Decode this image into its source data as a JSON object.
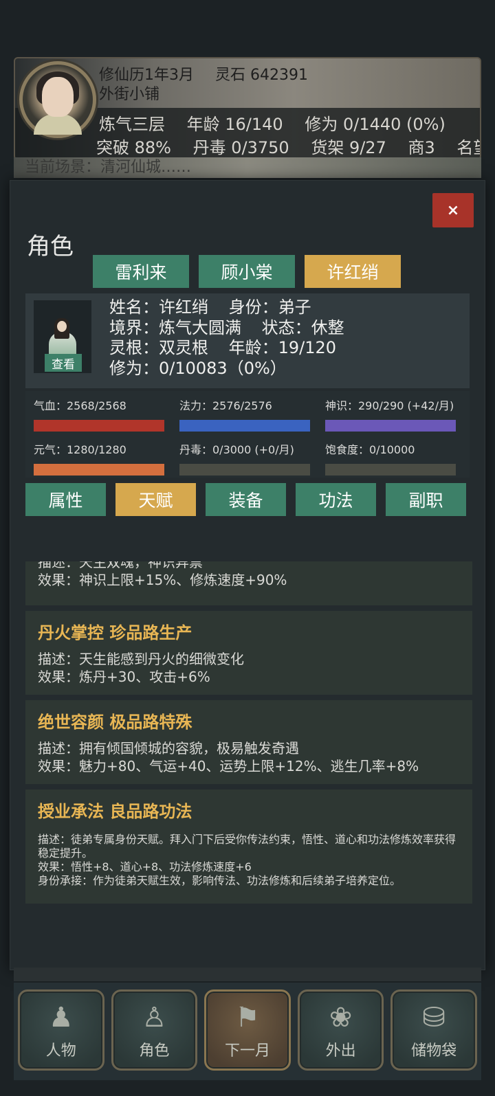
{
  "status": {
    "date": "修仙历1年3月",
    "spirit_stones": "灵石 642391",
    "location": "外街小铺",
    "realm": "炼气三层",
    "age": "年龄 16/140",
    "cultivation": "修为 0/1440 (0%)",
    "breakthrough": "突破 88%",
    "pill_toxin": "丹毒 0/3750",
    "shelves": "货架 9/27",
    "shop": "商3",
    "fame": "名望",
    "scene_partial": "当前场景：清河仙城……"
  },
  "modal": {
    "title": "角色",
    "close_label": "×",
    "characters": [
      {
        "label": "雷利来",
        "active": false
      },
      {
        "label": "顾小棠",
        "active": false
      },
      {
        "label": "许红绡",
        "active": true
      }
    ],
    "profile": {
      "name": "姓名：许红绡",
      "identity": "身份：弟子",
      "realm": "境界：炼气大圆满",
      "state": "状态：休整",
      "root": "灵根：双灵根",
      "age": "年龄：19/120",
      "cultivation": "修为：0/10083（0%）",
      "view_label": "查看"
    },
    "stats": [
      {
        "label": "气血：2568/2568",
        "fill": 1.0,
        "color": "#b1352a"
      },
      {
        "label": "法力：2576/2576",
        "fill": 1.0,
        "color": "#3a63c0"
      },
      {
        "label": "神识：290/290 (+42/月)",
        "fill": 1.0,
        "color": "#6b58b8"
      },
      {
        "label": "元气：1280/1280",
        "fill": 1.0,
        "color": "#d46f3e"
      },
      {
        "label": "丹毒：0/3000 (+0/月)",
        "fill": 0.0,
        "color": "#4a4c44"
      },
      {
        "label": "饱食度：0/10000",
        "fill": 0.0,
        "color": "#4a4c44"
      }
    ],
    "sections": [
      {
        "label": "属性",
        "active": false
      },
      {
        "label": "天赋",
        "active": true
      },
      {
        "label": "装备",
        "active": false
      },
      {
        "label": "功法",
        "active": false
      },
      {
        "label": "副职",
        "active": false
      }
    ],
    "talents": [
      {
        "partial_desc": "描述：天生双魂，神识异禀",
        "effect": "效果：神识上限+15%、修炼速度+90%"
      },
      {
        "title": "丹火掌控 珍品路生产",
        "desc": "描述：天生能感到丹火的细微变化",
        "effect": "效果：炼丹+30、攻击+6%"
      },
      {
        "title": "绝世容颜 极品路特殊",
        "desc": "描述：拥有倾国倾城的容貌，极易触发奇遇",
        "effect": "效果：魅力+80、气运+40、运势上限+12%、逃生几率+8%"
      },
      {
        "title": "授业承法 良品路功法",
        "desc": "描述：徒弟专属身份天赋。拜入门下后受你传法约束，悟性、道心和功法修炼效率获得稳定提升。",
        "effect": "效果：悟性+8、道心+8、功法修炼速度+6",
        "extra": "身份承接：作为徒弟天赋生效，影响传法、功法修炼和后续弟子培养定位。"
      }
    ]
  },
  "bottom_nav": [
    {
      "label": "人物",
      "icon": "person-icon",
      "active": false
    },
    {
      "label": "角色",
      "icon": "role-icon",
      "active": false
    },
    {
      "label": "下一月",
      "icon": "flag-icon",
      "active": true
    },
    {
      "label": "外出",
      "icon": "lotus-icon",
      "active": false
    },
    {
      "label": "储物袋",
      "icon": "bag-icon",
      "active": false
    }
  ]
}
